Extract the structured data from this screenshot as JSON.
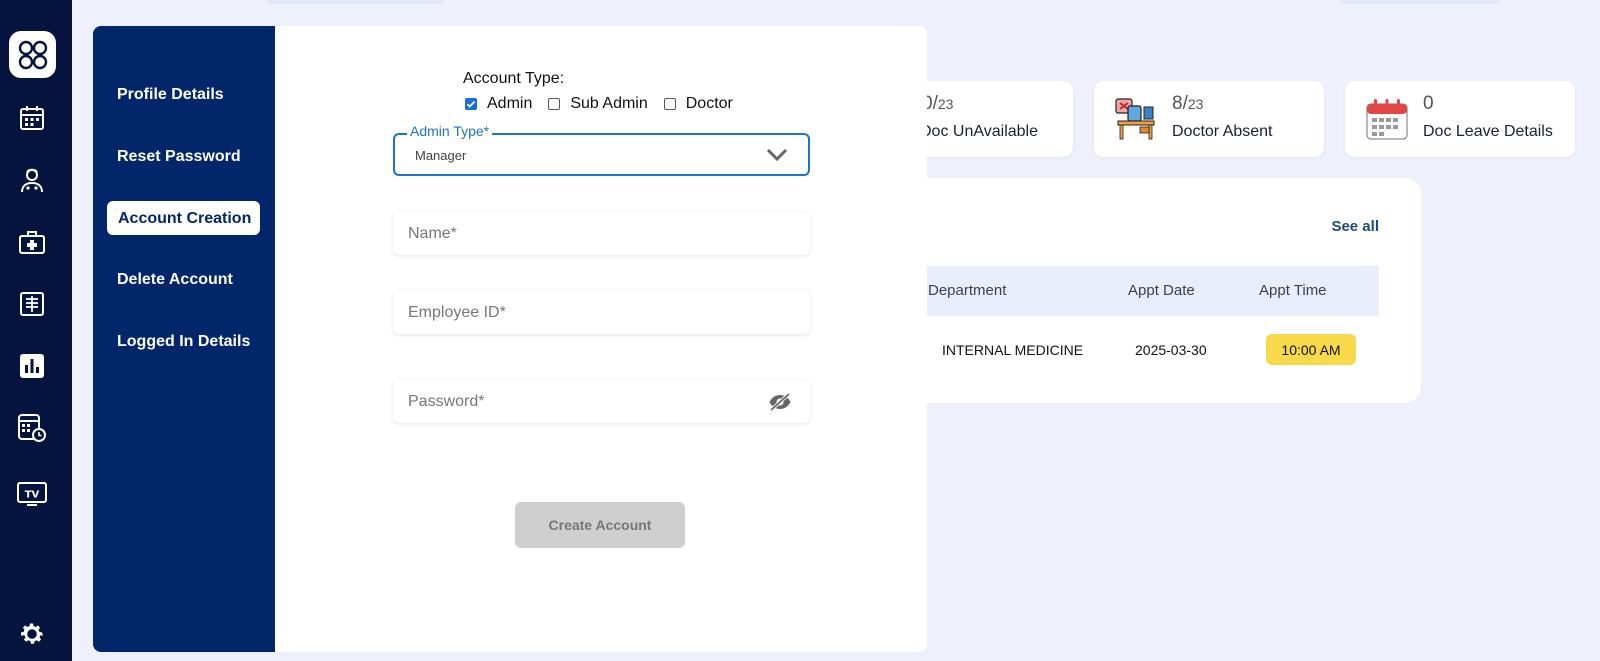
{
  "rail": {
    "items": [
      {
        "name": "dashboard-logo-icon"
      },
      {
        "name": "calendar-icon"
      },
      {
        "name": "doctor-icon"
      },
      {
        "name": "medical-kit-icon"
      },
      {
        "name": "xray-icon"
      },
      {
        "name": "bar-chart-icon"
      },
      {
        "name": "schedule-calculator-icon"
      },
      {
        "name": "tv-icon",
        "label": "TV"
      },
      {
        "name": "settings-gear-icon"
      }
    ]
  },
  "stats": [
    {
      "value": "0/",
      "total": "23",
      "label": "Doc UnAvailable"
    },
    {
      "value": "8/",
      "total": "23",
      "label": "Doctor Absent"
    },
    {
      "value": "0",
      "total": "",
      "label": "Doc Leave Details"
    }
  ],
  "appointments": {
    "see_all": "See all",
    "columns": [
      "Department",
      "Appt Date",
      "Appt Time"
    ],
    "rows": [
      {
        "department": "INTERNAL MEDICINE",
        "date": "2025-03-30",
        "time": "10:00 AM"
      }
    ]
  },
  "modal": {
    "nav": [
      {
        "label": "Profile Details",
        "active": false
      },
      {
        "label": "Reset Password",
        "active": false
      },
      {
        "label": "Account Creation",
        "active": true
      },
      {
        "label": "Delete Account",
        "active": false
      },
      {
        "label": "Logged In Details",
        "active": false
      }
    ],
    "form": {
      "account_type_label": "Account Type:",
      "account_types": [
        {
          "label": "Admin",
          "checked": true
        },
        {
          "label": "Sub Admin",
          "checked": false
        },
        {
          "label": "Doctor",
          "checked": false
        }
      ],
      "admin_type": {
        "label": "Admin Type*",
        "value": "Manager"
      },
      "name_placeholder": "Name*",
      "employee_id_placeholder": "Employee ID*",
      "password_placeholder": "Password*",
      "submit_label": "Create Account"
    }
  },
  "colors": {
    "rail_bg": "#04143f",
    "modal_side_bg": "#02266a",
    "accent": "#1b73cf",
    "time_badge": "#f8d94a"
  }
}
